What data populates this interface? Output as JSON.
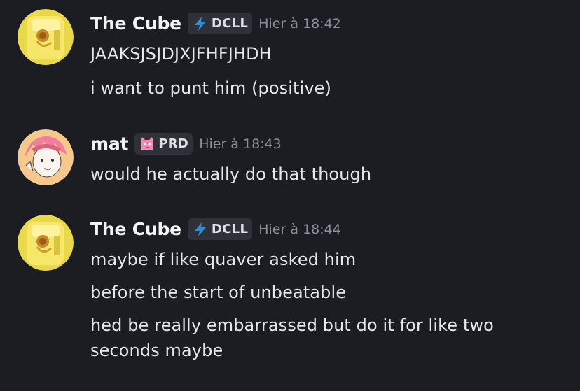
{
  "messages": [
    {
      "username": "The Cube",
      "tag": {
        "icon": "lightning-icon",
        "text": "DCLL"
      },
      "timestamp": "Hier à 18:42",
      "lines": [
        "JAAKSJSJDJXJFHFJHDH",
        "i want to punt him (positive)"
      ]
    },
    {
      "username": "mat",
      "tag": {
        "icon": "pink-cat-icon",
        "text": "PRD"
      },
      "timestamp": "Hier à 18:43",
      "lines": [
        "would he actually do that though"
      ]
    },
    {
      "username": "The Cube",
      "tag": {
        "icon": "lightning-icon",
        "text": "DCLL"
      },
      "timestamp": "Hier à 18:44",
      "lines": [
        "maybe if like quaver asked him",
        "before the start of unbeatable",
        "hed be really embarrassed but do it for like two seconds maybe"
      ]
    }
  ],
  "colors": {
    "background": "#1c1d23",
    "username": "#f2f3f5",
    "message_text": "#e6e7ec",
    "timestamp": "#8b8e98",
    "tag_background": "#2f3038",
    "lightning_blue": "#2b8fd8",
    "cat_pink": "#f28ab3"
  }
}
